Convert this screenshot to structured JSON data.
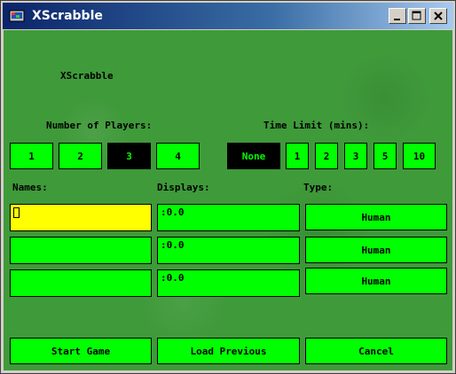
{
  "window": {
    "title": "XScrabble"
  },
  "header": {
    "app_label": "XScrabble"
  },
  "players": {
    "label": "Number of Players:",
    "options": [
      "1",
      "2",
      "3",
      "4"
    ],
    "selected": "3"
  },
  "time_limit": {
    "label": "Time Limit (mins):",
    "options": [
      "None",
      "1",
      "2",
      "3",
      "5",
      "10"
    ],
    "selected": "None"
  },
  "columns": {
    "names": "Names:",
    "displays": "Displays:",
    "type": "Type:"
  },
  "rows": [
    {
      "name": "",
      "display": ":0.0",
      "type": "Human"
    },
    {
      "name": "",
      "display": ":0.0",
      "type": "Human"
    },
    {
      "name": "",
      "display": ":0.0",
      "type": "Human"
    }
  ],
  "actions": {
    "start": "Start Game",
    "load": "Load Previous",
    "cancel": "Cancel"
  },
  "colors": {
    "accent": "#00ff00",
    "active_field": "#ffff00",
    "felt": "#3f9a3a"
  }
}
